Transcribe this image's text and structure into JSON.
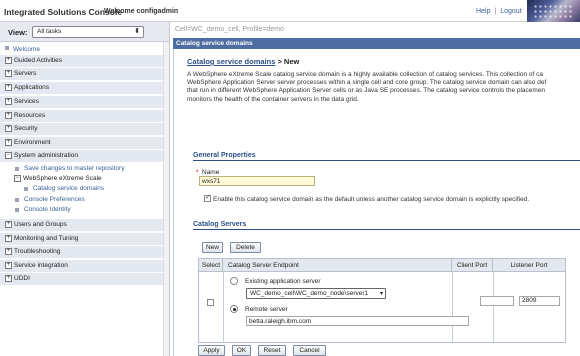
{
  "banner": {
    "title": "Integrated Solutions Console",
    "welcome": "Welcome configadmin",
    "help": "Help",
    "separator": "|",
    "logout": "Logout"
  },
  "nav": {
    "view_label": "View:",
    "view_value": "All tasks",
    "items": [
      {
        "label": "Welcome"
      },
      {
        "label": "Guided Activities"
      },
      {
        "label": "Servers"
      },
      {
        "label": "Applications"
      },
      {
        "label": "Services"
      },
      {
        "label": "Resources"
      },
      {
        "label": "Security"
      },
      {
        "label": "Environment"
      },
      {
        "label": "System administration"
      },
      {
        "label": "Save changes to master repository"
      },
      {
        "label": "WebSphere eXtreme Scale"
      },
      {
        "label": "Catalog service domains"
      },
      {
        "label": "Console Preferences"
      },
      {
        "label": "Console Identity"
      },
      {
        "label": "Users and Groups"
      },
      {
        "label": "Monitoring and Tuning"
      },
      {
        "label": "Troubleshooting"
      },
      {
        "label": "Service integration"
      },
      {
        "label": "UDDI"
      }
    ]
  },
  "content": {
    "scope": "Cell=WC_demo_cell, Profile=demo",
    "pane_title": "Catalog service domains",
    "breadcrumb_link": "Catalog service domains",
    "breadcrumb_current": "> New",
    "description_lines": [
      "A WebSphere eXtreme Scale catalog service domain is a highly available collection of catalog services. This collection of ca",
      "WebSphere Application Server server processes within a single cell and core group. The catalog service domain can also def",
      "that run in different WebSphere Application Server cells or as Java SE processes. The catalog service controls the placemen",
      "monitors the health of the container servers in the data grid."
    ],
    "general_properties": "General Properties",
    "required_marker": "*",
    "name_label": "Name",
    "name_value": "wxs71",
    "default_checkbox_text": "Enable this catalog service domain as the default unless another catalog service domain is explicitly specified.",
    "catalog_servers": "Catalog Servers",
    "new_button": "New",
    "delete_button": "Delete",
    "table": {
      "headers": [
        "Select",
        "Catalog Server Endpoint",
        "Client Port",
        "Listener Port"
      ],
      "existing_label": "Existing application server",
      "existing_value": "WC_demo_cell\\WC_demo_node\\server1",
      "remote_label": "Remote server",
      "remote_value": "betta.raleigh.ibm.com",
      "client_port": "",
      "listener_port": "2809"
    },
    "apply_button": "Apply",
    "ok_button": "OK",
    "reset_button": "Reset",
    "cancel_button": "Cancel"
  }
}
